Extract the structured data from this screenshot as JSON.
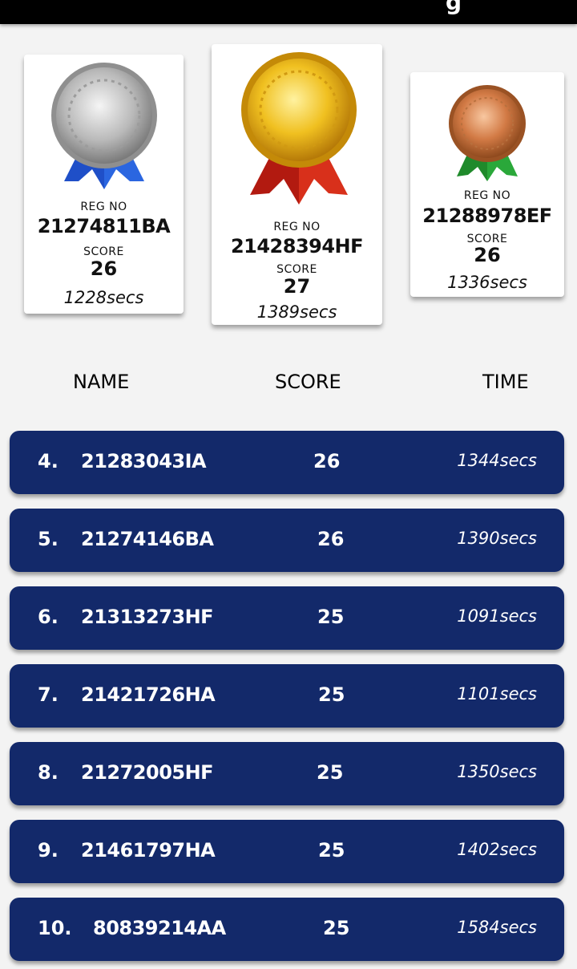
{
  "podium": {
    "labels": {
      "reg_no": "REG NO",
      "score": "SCORE"
    },
    "silver": {
      "reg_no": "21274811BA",
      "score": "26",
      "time": "1228secs",
      "icon": "silver-medal-icon"
    },
    "gold": {
      "reg_no": "21428394HF",
      "score": "27",
      "time": "1389secs",
      "icon": "gold-medal-icon"
    },
    "bronze": {
      "reg_no": "21288978EF",
      "score": "26",
      "time": "1336secs",
      "icon": "bronze-medal-icon"
    }
  },
  "table": {
    "headers": {
      "name": "NAME",
      "score": "SCORE",
      "time": "TIME"
    },
    "rows": [
      {
        "rank": "4.",
        "name": "21283043IA",
        "score": "26",
        "time": "1344secs"
      },
      {
        "rank": "5.",
        "name": "21274146BA",
        "score": "26",
        "time": "1390secs"
      },
      {
        "rank": "6.",
        "name": "21313273HF",
        "score": "25",
        "time": "1091secs"
      },
      {
        "rank": "7.",
        "name": "21421726HA",
        "score": "25",
        "time": "1101secs"
      },
      {
        "rank": "8.",
        "name": "21272005HF",
        "score": "25",
        "time": "1350secs"
      },
      {
        "rank": "9.",
        "name": "21461797HA",
        "score": "25",
        "time": "1402secs"
      },
      {
        "rank": "10.",
        "name": "80839214AA",
        "score": "25",
        "time": "1584secs"
      }
    ]
  },
  "colors": {
    "row_bg": "#13296a",
    "top_bar": "#000000",
    "page_bg": "#f3f3f3"
  }
}
